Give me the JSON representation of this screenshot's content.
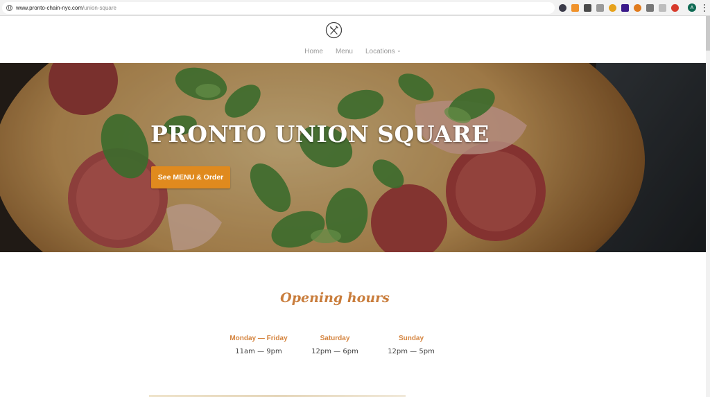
{
  "browser": {
    "url_host": "www.pronto-chain-nyc.com",
    "url_path": "/union-square",
    "extensions": [
      {
        "name": "dark-circle-icon",
        "color": "#3b3b4a"
      },
      {
        "name": "rss-icon",
        "color": "#f0922a"
      },
      {
        "name": "m-icon",
        "color": "#4a4a4a"
      },
      {
        "name": "note-icon",
        "color": "#9a9a9a"
      },
      {
        "name": "gear-flower-icon",
        "color": "#e6a21b"
      },
      {
        "name": "w-icon",
        "color": "#3b1a8a"
      },
      {
        "name": "bug-icon",
        "color": "#e07b1d"
      },
      {
        "name": "flag-icon",
        "color": "#777777"
      },
      {
        "name": "check-icon",
        "color": "#8a8a8a"
      },
      {
        "name": "shield-icon",
        "color": "#d73a2b"
      }
    ],
    "avatar_letter": "A"
  },
  "nav": {
    "home": "Home",
    "menu": "Menu",
    "locations": "Locations"
  },
  "hero": {
    "title": "PRONTO UNION SQUARE",
    "cta_label": "See MENU & Order"
  },
  "hours": {
    "title": "Opening hours",
    "days": [
      {
        "day": "Monday — Friday",
        "time": "11am — 9pm"
      },
      {
        "day": "Saturday",
        "time": "12pm — 6pm"
      },
      {
        "day": "Sunday",
        "time": "12pm — 5pm"
      }
    ]
  },
  "colors": {
    "accent": "#e08a1e",
    "hours_accent": "#c97d3c"
  }
}
